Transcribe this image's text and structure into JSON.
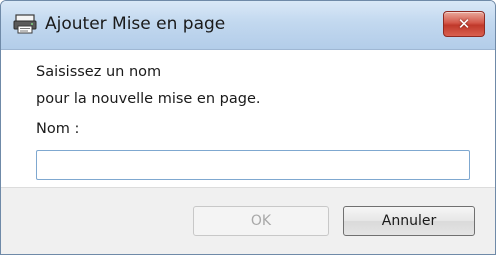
{
  "window": {
    "title": "Ajouter Mise en page",
    "close_glyph": "✕",
    "icon": "layout-icon"
  },
  "content": {
    "line1": "Saisissez un nom",
    "line2": "pour la nouvelle mise en page.",
    "name_label": "Nom :",
    "name_value": ""
  },
  "footer": {
    "ok_label": "OK",
    "cancel_label": "Annuler"
  },
  "colors": {
    "title_gradient_top": "#d9e8f7",
    "title_gradient_bottom": "#b3cde9",
    "close_red": "#c0392b",
    "footer_bg": "#f0f0f0"
  }
}
